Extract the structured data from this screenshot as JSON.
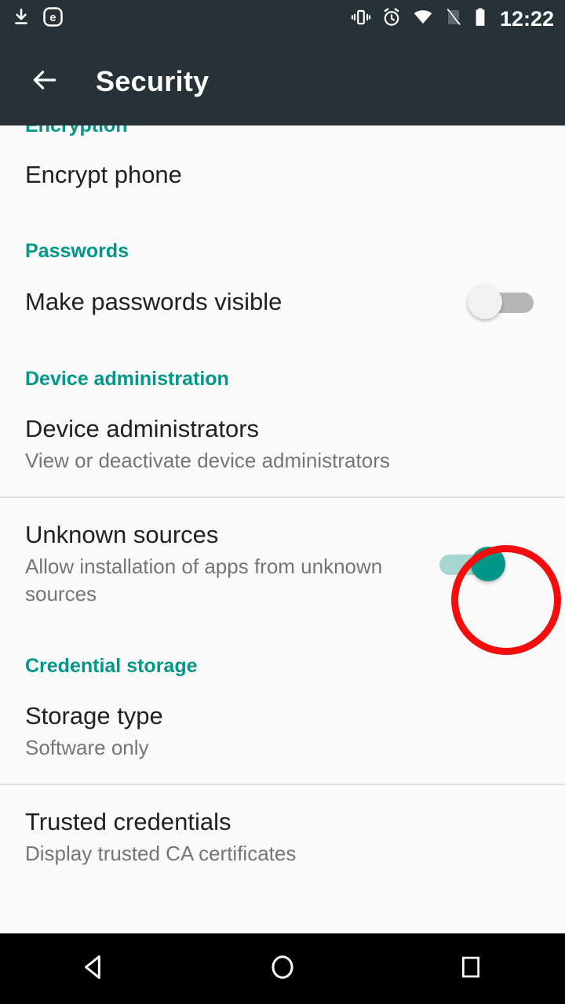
{
  "status_bar": {
    "left_icons": [
      "download-icon",
      "circled-e-icon"
    ],
    "right_icons": [
      "vibrate-icon",
      "alarm-icon",
      "wifi-icon",
      "no-sim-icon",
      "battery-icon"
    ],
    "time": "12:22"
  },
  "app_bar": {
    "back_icon": "back-arrow-icon",
    "title": "Security"
  },
  "colors": {
    "accent_teal": "#009688",
    "appbar_bg": "#263238",
    "page_bg": "#fafafa",
    "highlight_red": "#f40d0d",
    "primary_text": "#212121",
    "secondary_text": "#757575",
    "divider": "#e0e0e0",
    "track_on": "#a7d5cf",
    "track_off": "#b6b6b6"
  },
  "content": {
    "clipped_section_head": "Encryption",
    "rows": {
      "encrypt_phone": {
        "title": "Encrypt phone"
      },
      "passwords_head": {
        "label": "Passwords"
      },
      "make_passwords_visible": {
        "title": "Make passwords visible",
        "toggle_state": "off"
      },
      "device_administration_head": {
        "label": "Device administration"
      },
      "device_administrators": {
        "title": "Device administrators",
        "subtitle": "View or deactivate device administrators"
      },
      "unknown_sources": {
        "title": "Unknown sources",
        "subtitle": "Allow installation of apps from unknown sources",
        "toggle_state": "on",
        "highlighted": true
      },
      "credential_storage_head": {
        "label": "Credential storage"
      },
      "storage_type": {
        "title": "Storage type",
        "subtitle": "Software only"
      },
      "trusted_credentials": {
        "title": "Trusted credentials",
        "subtitle": "Display trusted CA certificates"
      }
    }
  },
  "nav_bar": {
    "back_icon": "nav-back-triangle-icon",
    "home_icon": "nav-home-circle-icon",
    "recents_icon": "nav-recents-square-icon"
  }
}
